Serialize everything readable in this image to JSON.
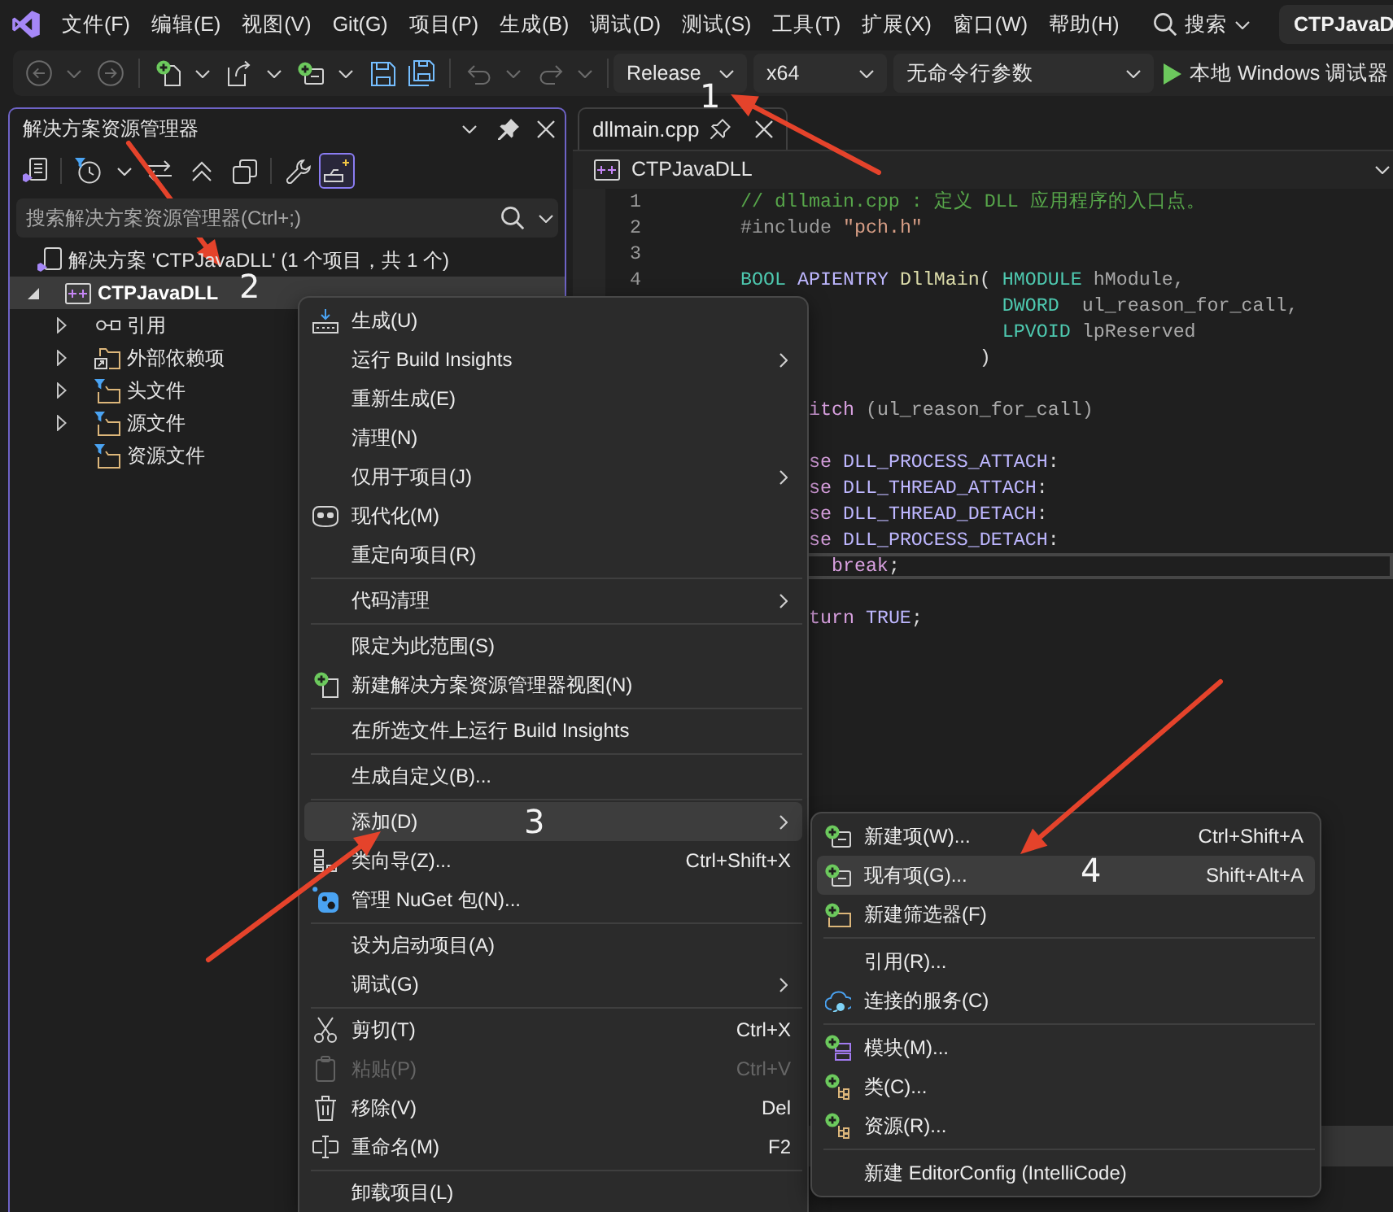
{
  "menu_bar": {
    "items": [
      "文件(F)",
      "编辑(E)",
      "视图(V)",
      "Git(G)",
      "项目(P)",
      "生成(B)",
      "调试(D)",
      "测试(S)",
      "工具(T)",
      "扩展(X)",
      "窗口(W)",
      "帮助(H)"
    ],
    "search": "搜索",
    "solution_name": "CTPJavaD"
  },
  "toolbar": {
    "groups": [
      [
        {
          "kind": "back",
          "disabled": true
        },
        {
          "kind": "caret",
          "disabled": true
        },
        {
          "kind": "forward",
          "disabled": true
        }
      ],
      [
        {
          "kind": "new-project",
          "disabled": false
        },
        {
          "kind": "caret",
          "disabled": false
        },
        {
          "kind": "open",
          "disabled": false
        },
        {
          "kind": "caret",
          "disabled": false
        },
        {
          "kind": "add-item",
          "disabled": false
        },
        {
          "kind": "caret",
          "disabled": false
        },
        {
          "kind": "save",
          "disabled": false
        },
        {
          "kind": "save-all",
          "disabled": false
        }
      ],
      [
        {
          "kind": "undo",
          "disabled": true
        },
        {
          "kind": "caret",
          "disabled": true
        },
        {
          "kind": "redo",
          "disabled": true
        },
        {
          "kind": "caret",
          "disabled": true
        }
      ]
    ],
    "selectors": [
      {
        "value": "Release"
      },
      {
        "value": "x64"
      },
      {
        "value": "无命令行参数"
      }
    ],
    "run_button": {
      "label": "本地 Windows 调试器"
    }
  },
  "solution_explorer": {
    "title": "解决方案资源管理器",
    "toolbar": [
      [
        {
          "kind": "views",
          "on": false
        }
      ],
      [
        {
          "kind": "history",
          "on": false
        },
        {
          "kind": "caret",
          "on": false
        },
        {
          "kind": "sync",
          "on": false
        },
        {
          "kind": "collapse",
          "on": false
        },
        {
          "kind": "show-all",
          "on": false
        }
      ],
      [
        {
          "kind": "properties",
          "on": false
        },
        {
          "kind": "preview",
          "on": true
        }
      ]
    ],
    "search": {
      "placeholder": "搜索解决方案资源管理器(Ctrl+;)"
    },
    "tree": [
      {
        "label": "解决方案 'CTPJavaDLL' (1 个项目，共 1 个)",
        "kind": "solution",
        "expandable": false,
        "selected": false,
        "children": [
          {
            "label": "CTPJavaDLL",
            "kind": "project",
            "expandable": true,
            "expanded": true,
            "selected": true,
            "children": [
              {
                "label": "引用",
                "kind": "references",
                "expandable": true,
                "expanded": false,
                "selected": false
              },
              {
                "label": "外部依赖项",
                "kind": "external",
                "expandable": true,
                "expanded": false,
                "selected": false
              },
              {
                "label": "头文件",
                "kind": "filter",
                "expandable": true,
                "expanded": false,
                "selected": false
              },
              {
                "label": "源文件",
                "kind": "filter",
                "expandable": true,
                "expanded": false,
                "selected": false
              },
              {
                "label": "资源文件",
                "kind": "filter",
                "expandable": false,
                "selected": false
              }
            ]
          }
        ]
      }
    ]
  },
  "editor": {
    "tabs": [
      {
        "label": "dllmain.cpp",
        "selected": true,
        "pinned": false
      }
    ],
    "navigation": "CTPJavaDLL",
    "lines": [
      {
        "number": "1",
        "current": false,
        "tokens": [
          {
            "text": "// dllmain.cpp : 定义 DLL 应用程序的入口点。",
            "kind": "comment"
          }
        ]
      },
      {
        "number": "2",
        "current": false,
        "tokens": [
          {
            "text": "#include",
            "kind": "preprocessor"
          },
          {
            "text": " \"pch.h\"",
            "kind": "string"
          }
        ]
      },
      {
        "number": "3",
        "current": false
      },
      {
        "number": "4",
        "current": false,
        "tokens": [
          {
            "text": "BOOL",
            "kind": "type"
          },
          {
            "text": " APIENTRY",
            "kind": "macro"
          },
          {
            "text": " DllMain",
            "kind": "function"
          },
          {
            "text": "( ",
            "kind": "punct"
          },
          {
            "text": "HMODULE",
            "kind": "type"
          },
          {
            "text": " hModule,",
            "kind": "param"
          }
        ]
      },
      {
        "current": false,
        "tokens": [
          {
            "text": "                       DWORD",
            "kind": "type"
          },
          {
            "text": "  ul_reason_for_call,",
            "kind": "param"
          }
        ]
      },
      {
        "current": false,
        "tokens": [
          {
            "text": "                       LPVOID",
            "kind": "type"
          },
          {
            "text": " lpReserved",
            "kind": "param"
          }
        ]
      },
      {
        "current": false,
        "tokens": [
          {
            "text": "                     )",
            "kind": "punct"
          }
        ]
      },
      {
        "current": false
      },
      {
        "current": false,
        "tokens": [
          {
            "text": "      itch",
            "kind": "control"
          },
          {
            "text": " (ul_reason_for_call)",
            "kind": "param"
          }
        ]
      },
      {
        "current": false
      },
      {
        "current": false,
        "tokens": [
          {
            "text": "      se",
            "kind": "control"
          },
          {
            "text": " DLL_PROCESS_ATTACH",
            "kind": "macro"
          },
          {
            "text": ":",
            "kind": "punct"
          }
        ]
      },
      {
        "current": false,
        "tokens": [
          {
            "text": "      se",
            "kind": "control"
          },
          {
            "text": " DLL_THREAD_ATTACH",
            "kind": "macro"
          },
          {
            "text": ":",
            "kind": "punct"
          }
        ]
      },
      {
        "current": false,
        "tokens": [
          {
            "text": "      se",
            "kind": "control"
          },
          {
            "text": " DLL_THREAD_DETACH",
            "kind": "macro"
          },
          {
            "text": ":",
            "kind": "punct"
          }
        ]
      },
      {
        "current": false,
        "tokens": [
          {
            "text": "      se",
            "kind": "control"
          },
          {
            "text": " DLL_PROCESS_DETACH",
            "kind": "macro"
          },
          {
            "text": ":",
            "kind": "punct"
          }
        ]
      },
      {
        "current": true,
        "tokens": [
          {
            "text": "        break",
            "kind": "control"
          },
          {
            "text": ";",
            "kind": "punct"
          }
        ]
      },
      {
        "current": false
      },
      {
        "current": false,
        "tokens": [
          {
            "text": "      turn",
            "kind": "control"
          },
          {
            "text": " TRUE",
            "kind": "macro"
          },
          {
            "text": ";",
            "kind": "punct"
          }
        ]
      }
    ]
  },
  "context_menu": {
    "groups": [
      [
        {
          "label": "生成(U)",
          "kind": "build",
          "selected": false,
          "disabled": false,
          "submenu": false
        },
        {
          "label": "运行 Build Insights",
          "kind": "plain",
          "selected": false,
          "disabled": false,
          "submenu": true
        },
        {
          "label": "重新生成(E)",
          "kind": "plain",
          "selected": false,
          "disabled": false,
          "submenu": false
        },
        {
          "label": "清理(N)",
          "kind": "plain",
          "selected": false,
          "disabled": false,
          "submenu": false
        },
        {
          "label": "仅用于项目(J)",
          "kind": "plain",
          "selected": false,
          "disabled": false,
          "submenu": true
        },
        {
          "label": "现代化(M)",
          "kind": "modernize",
          "selected": false,
          "disabled": false,
          "submenu": false
        },
        {
          "label": "重定向项目(R)",
          "kind": "plain",
          "selected": false,
          "disabled": false,
          "submenu": false
        }
      ],
      [
        {
          "label": "代码清理",
          "kind": "plain",
          "selected": false,
          "disabled": false,
          "submenu": true
        }
      ],
      [
        {
          "label": "限定为此范围(S)",
          "kind": "plain",
          "selected": false,
          "disabled": false,
          "submenu": false
        },
        {
          "label": "新建解决方案资源管理器视图(N)",
          "kind": "new-view",
          "selected": false,
          "disabled": false,
          "submenu": false
        }
      ],
      [
        {
          "label": "在所选文件上运行 Build Insights",
          "kind": "plain",
          "selected": false,
          "disabled": false,
          "submenu": false
        }
      ],
      [
        {
          "label": "生成自定义(B)...",
          "kind": "plain",
          "selected": false,
          "disabled": false,
          "submenu": false
        }
      ],
      [
        {
          "label": "添加(D)",
          "kind": "plain",
          "selected": true,
          "disabled": false,
          "submenu": true
        },
        {
          "label": "类向导(Z)...",
          "kind": "class-wizard",
          "selected": false,
          "disabled": false,
          "submenu": false,
          "shortcut": "Ctrl+Shift+X"
        },
        {
          "label": "管理 NuGet 包(N)...",
          "kind": "nuget",
          "selected": false,
          "disabled": false,
          "submenu": false
        }
      ],
      [
        {
          "label": "设为启动项目(A)",
          "kind": "plain",
          "selected": false,
          "disabled": false,
          "submenu": false
        },
        {
          "label": "调试(G)",
          "kind": "plain",
          "selected": false,
          "disabled": false,
          "submenu": true
        }
      ],
      [
        {
          "label": "剪切(T)",
          "kind": "cut",
          "selected": false,
          "disabled": false,
          "submenu": false,
          "shortcut": "Ctrl+X"
        },
        {
          "label": "粘贴(P)",
          "kind": "paste",
          "selected": false,
          "disabled": true,
          "submenu": false,
          "shortcut": "Ctrl+V"
        },
        {
          "label": "移除(V)",
          "kind": "remove",
          "selected": false,
          "disabled": false,
          "submenu": false,
          "shortcut": "Del"
        },
        {
          "label": "重命名(M)",
          "kind": "rename",
          "selected": false,
          "disabled": false,
          "submenu": false,
          "shortcut": "F2"
        }
      ],
      [
        {
          "label": "卸载项目(L)",
          "kind": "plain",
          "selected": false,
          "disabled": false,
          "submenu": false
        }
      ]
    ]
  },
  "add_submenu": {
    "groups": [
      [
        {
          "label": "新建项(W)...",
          "kind": "new-item",
          "selected": false,
          "disabled": false,
          "submenu": false,
          "shortcut": "Ctrl+Shift+A"
        },
        {
          "label": "现有项(G)...",
          "kind": "existing-item",
          "selected": true,
          "disabled": false,
          "submenu": false,
          "shortcut": "Shift+Alt+A"
        },
        {
          "label": "新建筛选器(F)",
          "kind": "new-filter",
          "selected": false,
          "disabled": false,
          "submenu": false
        }
      ],
      [
        {
          "label": "引用(R)...",
          "kind": "plain",
          "selected": false,
          "disabled": false,
          "submenu": false
        },
        {
          "label": "连接的服务(C)",
          "kind": "connected-service",
          "selected": false,
          "disabled": false,
          "submenu": false
        }
      ],
      [
        {
          "label": "模块(M)...",
          "kind": "module",
          "selected": false,
          "disabled": false,
          "submenu": false
        },
        {
          "label": "类(C)...",
          "kind": "class",
          "selected": false,
          "disabled": false,
          "submenu": false
        },
        {
          "label": "资源(R)...",
          "kind": "resource",
          "selected": false,
          "disabled": false,
          "submenu": false
        }
      ],
      [
        {
          "label": "新建 EditorConfig (IntelliCode)",
          "kind": "plain",
          "selected": false,
          "disabled": false,
          "submenu": false
        }
      ]
    ]
  },
  "annotations": [
    {
      "label": "1"
    },
    {
      "label": "2"
    },
    {
      "label": "3"
    },
    {
      "label": "4"
    }
  ]
}
